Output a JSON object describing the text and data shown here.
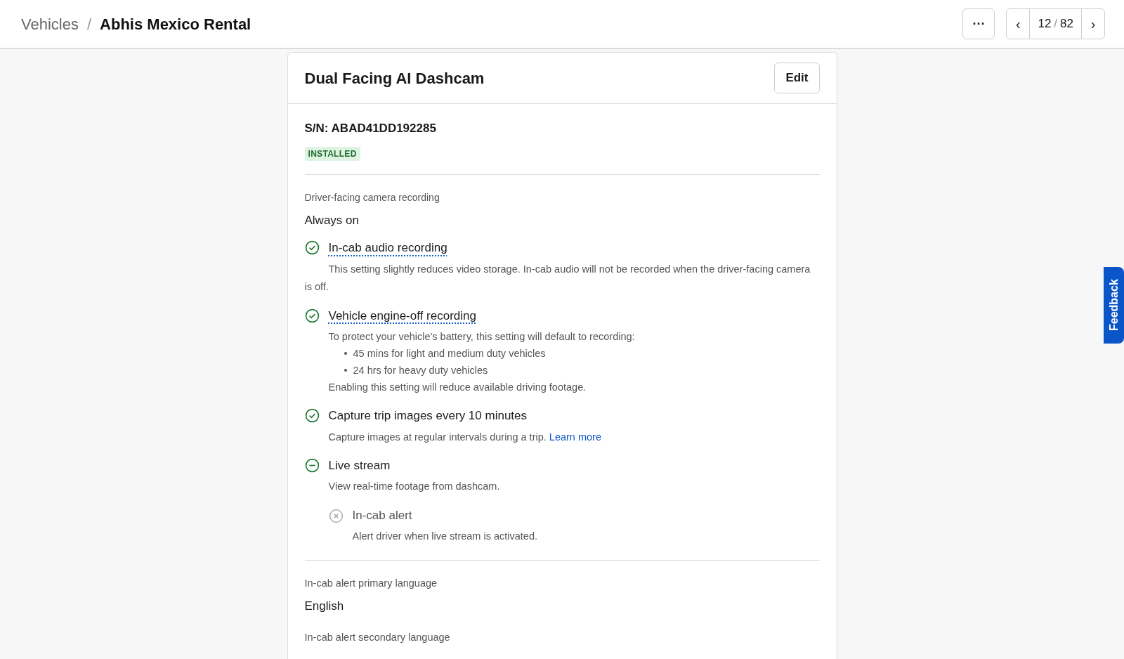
{
  "breadcrumb": [
    {
      "label": "Vehicles",
      "current": false
    },
    {
      "label": "Abhis Mexico Rental",
      "current": true
    }
  ],
  "breadcrumb_separator": "/",
  "pager": {
    "more": "···",
    "prev": "‹",
    "current": "12",
    "separator": "/",
    "total": "82",
    "next": "›"
  },
  "card": {
    "title": "Dual Facing AI Dashcam",
    "edit_button": "Edit",
    "serial": "S/N: ABAD41DD192285",
    "status_badge": "INSTALLED",
    "recording": {
      "label": "Driver-facing camera recording",
      "value": "Always on"
    },
    "features": [
      {
        "title": "In-cab audio recording",
        "kind": "enabled",
        "tooltip": true,
        "description": "This setting slightly reduces video storage. In-cab audio will not be recorded when the driver-facing camera is off.",
        "hanging_indent": true
      },
      {
        "title": "Vehicle engine-off recording",
        "kind": "enabled",
        "tooltip": true,
        "description": "To protect your vehicle's battery, this setting will default to recording:",
        "bullets": [
          "45 mins for light and medium duty vehicles",
          "24 hrs for heavy duty vehicles"
        ],
        "note": "Enabling this setting will reduce available driving footage."
      },
      {
        "title": "Capture trip images every 10 minutes",
        "kind": "enabled",
        "tooltip": false,
        "description": "Capture images at regular intervals during a trip.",
        "link": "Learn more"
      },
      {
        "title": "Live stream",
        "kind": "partial",
        "tooltip": false,
        "description": "View real-time footage from dashcam.",
        "children": [
          {
            "title": "In-cab alert",
            "kind": "disabled",
            "tooltip": false,
            "description": "Alert driver when live stream is activated."
          }
        ]
      }
    ],
    "languages": [
      {
        "label": "In-cab alert primary language",
        "value": "English"
      },
      {
        "label": "In-cab alert secondary language"
      }
    ]
  },
  "feedback_tab": "Feedback"
}
